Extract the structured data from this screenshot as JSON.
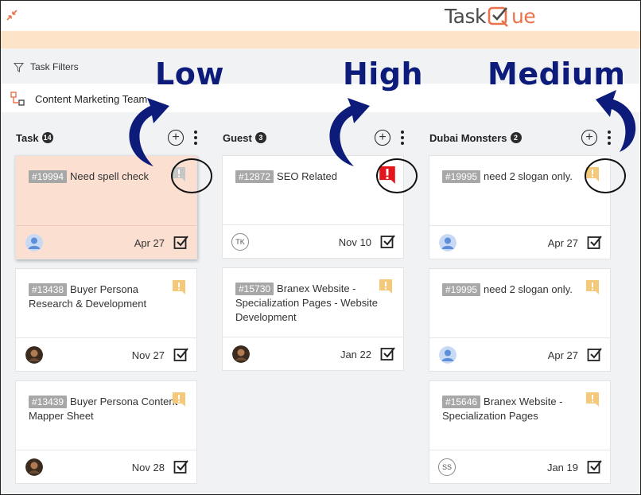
{
  "app": {
    "brand_left": "Task",
    "brand_right": "ue",
    "accent": "#e8734a",
    "band_color": "#fde4c8"
  },
  "toolbar": {
    "filters_label": "Task Filters"
  },
  "team": {
    "name": "Content Marketing Team"
  },
  "annotations": {
    "low": "Low",
    "high": "High",
    "medium": "Medium",
    "color": "#0d1b7a"
  },
  "priority_colors": {
    "low": "#c6c6c6",
    "high": "#e3161b",
    "medium": "#f5c97a"
  },
  "columns": [
    {
      "title": "Task",
      "count": "14",
      "cards": [
        {
          "id": "#19994",
          "title": "Need spell check",
          "date": "Apr 27",
          "priority": "low",
          "avatar": "person"
        },
        {
          "id": "#13438",
          "title": "Buyer Persona Research & Development",
          "date": "Nov 27",
          "priority": "medium",
          "avatar": "photo"
        },
        {
          "id": "#13439",
          "title": "Buyer Persona Content Mapper Sheet",
          "date": "Nov 28",
          "priority": "medium",
          "avatar": "photo"
        }
      ]
    },
    {
      "title": "Guest",
      "count": "3",
      "cards": [
        {
          "id": "#12872",
          "title": "SEO Related",
          "date": "Nov 10",
          "priority": "high",
          "avatar": "TK"
        },
        {
          "id": "#15730",
          "title": "Branex Website - Specialization Pages - Website Development",
          "date": "Jan 22",
          "priority": "medium",
          "avatar": "photo"
        }
      ]
    },
    {
      "title": "Dubai Monsters",
      "count": "2",
      "cards": [
        {
          "id": "#19995",
          "title": "need 2 slogan only.",
          "date": "Apr 27",
          "priority": "medium",
          "avatar": "person"
        },
        {
          "id": "#19995",
          "title": "need 2 slogan only.",
          "date": "Apr 27",
          "priority": "medium",
          "avatar": "person"
        },
        {
          "id": "#15646",
          "title": "Branex Website - Specialization Pages",
          "date": "Jan 19",
          "priority": "medium",
          "avatar": "SS"
        }
      ]
    }
  ]
}
